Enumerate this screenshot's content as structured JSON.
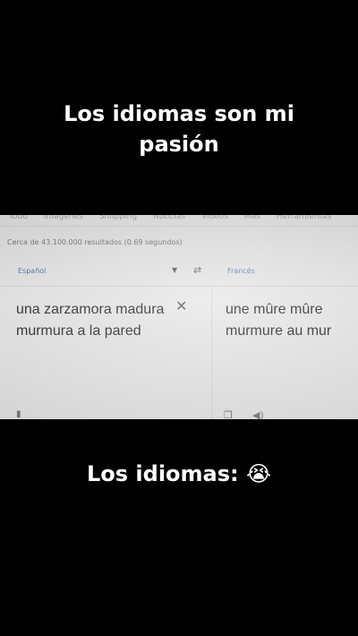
{
  "captions": {
    "top": "Los idiomas son mi pasión",
    "bottom": "Los idiomas: 😭"
  },
  "search": {
    "tabs": [
      "Todo",
      "Imágenes",
      "Shopping",
      "Noticias",
      "Videos",
      "Más",
      "Herramientas"
    ],
    "results_count": "Cerca de 43.100.000 resultados (0.69 segundos)"
  },
  "translator": {
    "source_language": "Español",
    "target_language": "Francés",
    "source_text": "una zarzamora madura murmura a la pared",
    "target_text": "une mûre mûre\nmurmure au mur"
  },
  "icons": {
    "swap": "swap-arrows-icon",
    "clear": "close-icon",
    "dropdown": "chevron-down-icon",
    "copy": "copy-icon",
    "speak": "speaker-icon",
    "mic": "microphone-icon"
  }
}
